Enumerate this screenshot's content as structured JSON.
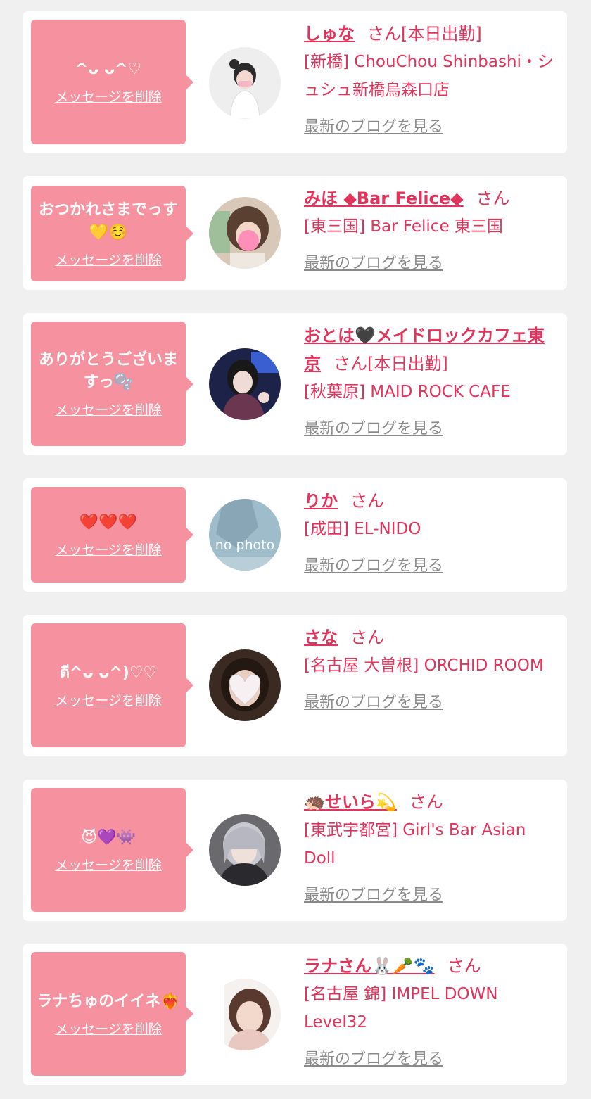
{
  "cards": [
    {
      "message": "^ᴗ ᴗ^♡",
      "delete_label": "メッセージを削除",
      "name": "しゅな",
      "honorific": "さん[本日出勤]",
      "shop": "[新橋] ChouChou Shinbashi・シュシュ新橋烏森口店",
      "blog_label": "最新のブログを見る"
    },
    {
      "message": "おつかれさまでっす💛☺️",
      "delete_label": "メッセージを削除",
      "name": "みほ ◆Bar Felice◆",
      "honorific": "さん",
      "shop": "[東三国] Bar Felice 東三国",
      "blog_label": "最新のブログを見る"
    },
    {
      "message": "ありがとうございますっ🫧",
      "delete_label": "メッセージを削除",
      "name": "おとは🖤メイドロックカフェ東京",
      "honorific": "さん[本日出勤]",
      "shop": "[秋葉原] MAID ROCK CAFE",
      "blog_label": "最新のブログを見る"
    },
    {
      "message": "❤️❤️❤️",
      "delete_label": "メッセージを削除",
      "name": "りか",
      "honorific": "さん",
      "shop": "[成田] EL-NIDO",
      "blog_label": "最新のブログを見る",
      "avatar_text": "no photo"
    },
    {
      "message": "ดี^ᴗ ᴗ^)♡♡",
      "delete_label": "メッセージを削除",
      "name": "さな",
      "honorific": "さん",
      "shop": "[名古屋 大曽根] ORCHID ROOM",
      "blog_label": "最新のブログを見る"
    },
    {
      "message": "😈💜👾",
      "delete_label": "メッセージを削除",
      "name": "🦔せいら💫",
      "honorific": "さん",
      "shop": "[東武宇都宮] Girl's Bar Asian Doll",
      "blog_label": "最新のブログを見る"
    },
    {
      "message": "ラナちゅのイイネ❤️‍🔥",
      "delete_label": "メッセージを削除",
      "name": "ラナさん🐰🥕🐾",
      "honorific": "さん",
      "shop": "[名古屋 錦] IMPEL DOWN Level32",
      "blog_label": "最新のブログを見る"
    }
  ]
}
